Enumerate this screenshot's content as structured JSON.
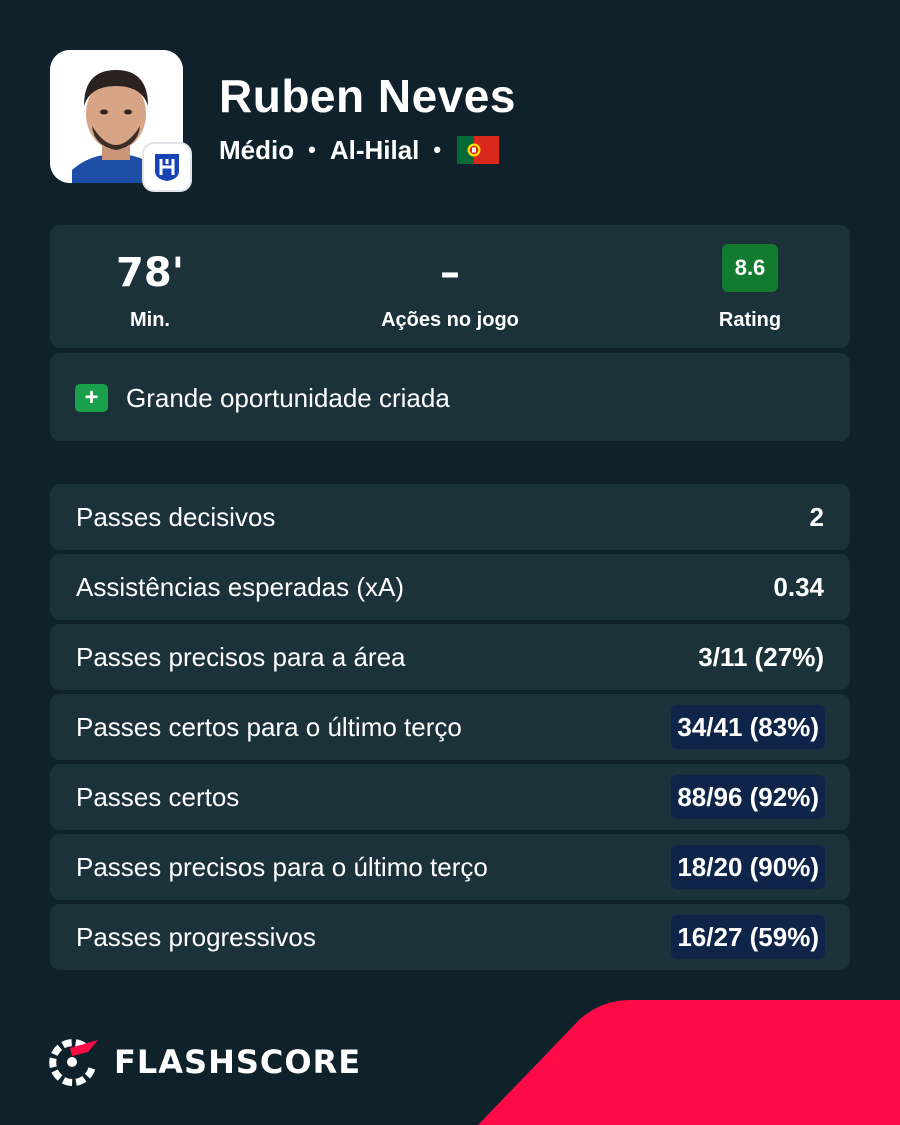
{
  "player": {
    "name": "Ruben Neves",
    "position": "Médio",
    "separator": "•",
    "club": "Al-Hilal",
    "nationality_flag": "portugal-flag-icon"
  },
  "summary": {
    "minutes_value": "78'",
    "minutes_label": "Min.",
    "actions_value": "–",
    "actions_label": "Ações no jogo",
    "rating_value": "8.6",
    "rating_label": "Rating"
  },
  "event": {
    "icon": "plus-icon",
    "text": "Grande oportunidade criada"
  },
  "stats": [
    {
      "label": "Passes decisivos",
      "value": "2",
      "highlight": false
    },
    {
      "label": "Assistências esperadas (xA)",
      "value": "0.34",
      "highlight": false
    },
    {
      "label": "Passes precisos para a área",
      "value": "3/11 (27%)",
      "highlight": false
    },
    {
      "label": "Passes certos para o último terço",
      "value": "34/41 (83%)",
      "highlight": true
    },
    {
      "label": "Passes certos",
      "value": "88/96 (92%)",
      "highlight": true
    },
    {
      "label": "Passes precisos para o último terço",
      "value": "18/20 (90%)",
      "highlight": true
    },
    {
      "label": "Passes progressivos",
      "value": "16/27 (59%)",
      "highlight": true
    }
  ],
  "brand": {
    "name": "FLASHSCORE"
  },
  "colors": {
    "background": "#0f222b",
    "card": "#1c323b",
    "rating_green": "#117c2f",
    "plus_green": "#1aa04b",
    "highlight_navy": "#0e2549",
    "brand_red": "#ff0a46"
  }
}
